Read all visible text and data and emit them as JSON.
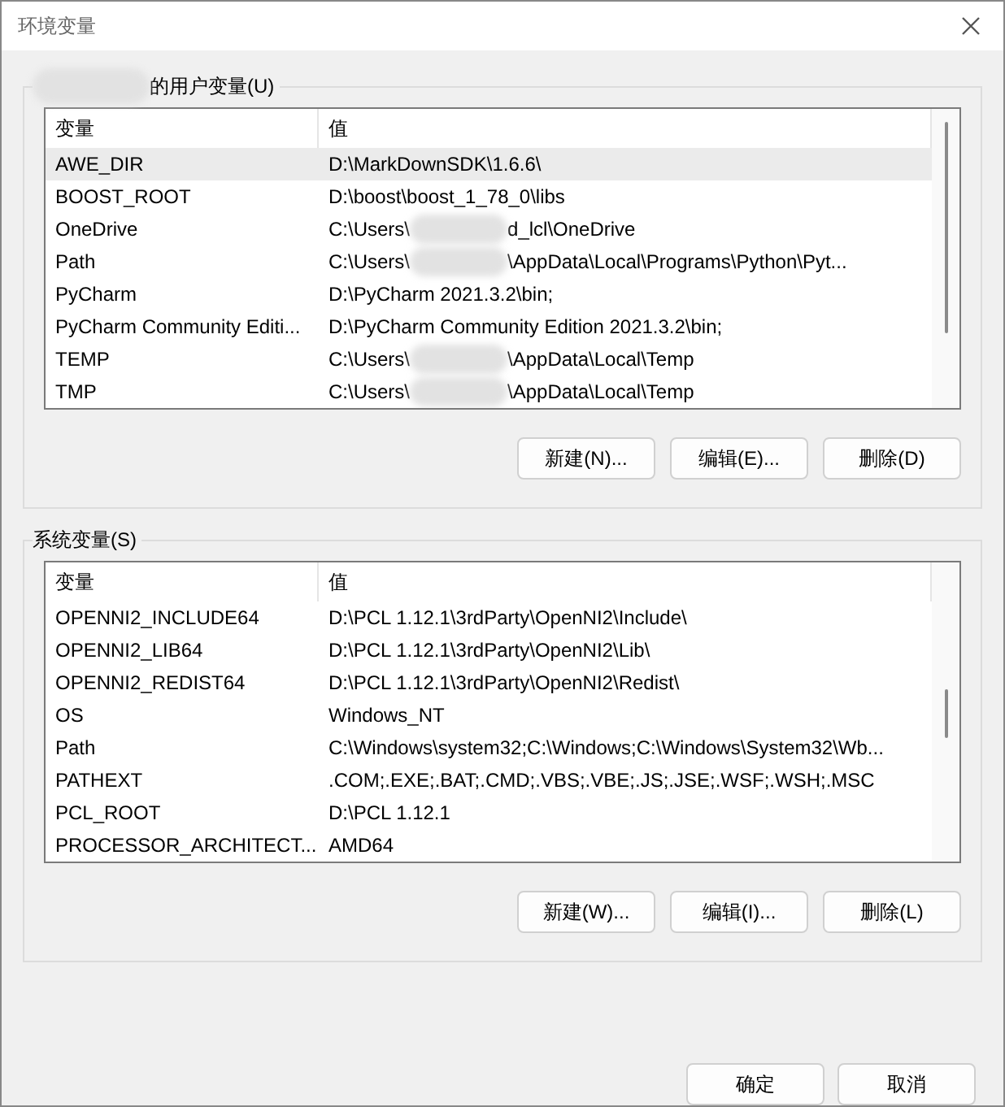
{
  "window": {
    "title": "环境变量"
  },
  "user_vars": {
    "title": "的用户变量(U)",
    "columns": [
      "变量",
      "值"
    ],
    "rows": [
      {
        "name": "AWE_DIR",
        "value": [
          "D:\\MarkDownSDK\\1.6.6\\"
        ],
        "selected": true
      },
      {
        "name": "BOOST_ROOT",
        "value": [
          "D:\\boost\\boost_1_78_0\\libs"
        ],
        "selected": false
      },
      {
        "name": "OneDrive",
        "value": [
          "C:\\Users\\",
          "d_lcl\\OneDrive"
        ],
        "selected": false
      },
      {
        "name": "Path",
        "value": [
          "C:\\Users\\",
          "\\AppData\\Local\\Programs\\Python\\Pyt..."
        ],
        "selected": false
      },
      {
        "name": "PyCharm",
        "value": [
          "D:\\PyCharm 2021.3.2\\bin;"
        ],
        "selected": false
      },
      {
        "name": "PyCharm Community Editi...",
        "value": [
          "D:\\PyCharm Community Edition 2021.3.2\\bin;"
        ],
        "selected": false
      },
      {
        "name": "TEMP",
        "value": [
          "C:\\Users\\",
          "\\AppData\\Local\\Temp"
        ],
        "selected": false
      },
      {
        "name": "TMP",
        "value": [
          "C:\\Users\\",
          "\\AppData\\Local\\Temp"
        ],
        "selected": false
      }
    ],
    "buttons": [
      "新建(N)...",
      "编辑(E)...",
      "删除(D)"
    ]
  },
  "system_vars": {
    "title": "系统变量(S)",
    "columns": [
      "变量",
      "值"
    ],
    "rows": [
      {
        "name": "OPENNI2_INCLUDE64",
        "value": [
          "D:\\PCL 1.12.1\\3rdParty\\OpenNI2\\Include\\"
        ],
        "selected": false
      },
      {
        "name": "OPENNI2_LIB64",
        "value": [
          "D:\\PCL 1.12.1\\3rdParty\\OpenNI2\\Lib\\"
        ],
        "selected": false
      },
      {
        "name": "OPENNI2_REDIST64",
        "value": [
          "D:\\PCL 1.12.1\\3rdParty\\OpenNI2\\Redist\\"
        ],
        "selected": false
      },
      {
        "name": "OS",
        "value": [
          "Windows_NT"
        ],
        "selected": false
      },
      {
        "name": "Path",
        "value": [
          "C:\\Windows\\system32;C:\\Windows;C:\\Windows\\System32\\Wb..."
        ],
        "selected": false
      },
      {
        "name": "PATHEXT",
        "value": [
          ".COM;.EXE;.BAT;.CMD;.VBS;.VBE;.JS;.JSE;.WSF;.WSH;.MSC"
        ],
        "selected": false
      },
      {
        "name": "PCL_ROOT",
        "value": [
          "D:\\PCL 1.12.1"
        ],
        "selected": false
      },
      {
        "name": "PROCESSOR_ARCHITECT...",
        "value": [
          "AMD64"
        ],
        "selected": false
      }
    ],
    "buttons": [
      "新建(W)...",
      "编辑(I)...",
      "删除(L)"
    ]
  },
  "footer_buttons": [
    "确定",
    "取消"
  ]
}
